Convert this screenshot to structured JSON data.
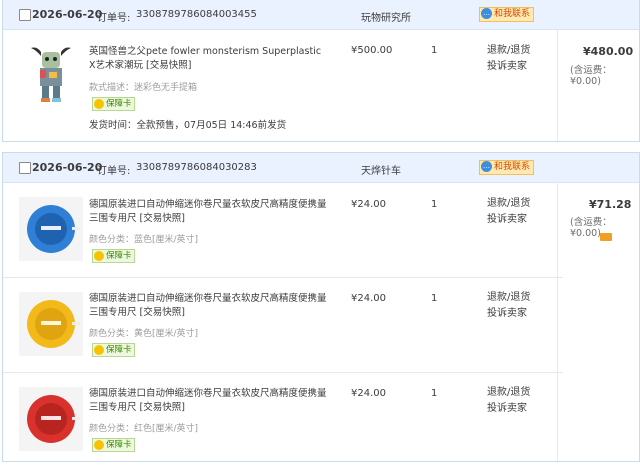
{
  "orders": [
    {
      "date": "2026-06-20",
      "order_label": "订单号:",
      "order_no": "3308789786084003455",
      "shop": "玩物研究所",
      "contact": "和我联系",
      "total": "¥480.00",
      "shipping_note": "(含运费：¥0.00)",
      "items": [
        {
          "title": "英国怪兽之父pete fowler monsterism Superplastic X艺术家潮玩 [交易快照]",
          "attr": "款式描述：迷彩色无手提箱",
          "badge": "保障卡",
          "ship_time": "发货时间：全款预售，07月05日 14:46前发货",
          "price": "¥500.00",
          "qty": "1",
          "action1": "退款/退货",
          "action2": "投诉卖家"
        }
      ]
    },
    {
      "date": "2026-06-20",
      "order_label": "订单号:",
      "order_no": "3308789786084030283",
      "shop": "天烨针车",
      "contact": "和我联系",
      "total": "¥71.28",
      "shipping_note": "(含运费：¥0.00)",
      "items": [
        {
          "title": "德国原装进口自动伸缩迷你卷尺量衣软皮尺高精度便携量三围专用尺 [交易快照]",
          "attr": "颜色分类：蓝色[厘米/英寸]",
          "badge": "保障卡",
          "price": "¥24.00",
          "qty": "1",
          "action1": "退款/退货",
          "action2": "投诉卖家",
          "color": "#2f7fd6"
        },
        {
          "title": "德国原装进口自动伸缩迷你卷尺量衣软皮尺高精度便携量三围专用尺 [交易快照]",
          "attr": "颜色分类：黄色[厘米/英寸]",
          "badge": "保障卡",
          "price": "¥24.00",
          "qty": "1",
          "action1": "退款/退货",
          "action2": "投诉卖家",
          "color": "#f3b91a"
        },
        {
          "title": "德国原装进口自动伸缩迷你卷尺量衣软皮尺高精度便携量三围专用尺 [交易快照]",
          "attr": "颜色分类：红色[厘米/英寸]",
          "badge": "保障卡",
          "price": "¥24.00",
          "qty": "1",
          "action1": "退款/退货",
          "action2": "投诉卖家",
          "color": "#d9322c"
        }
      ]
    }
  ]
}
